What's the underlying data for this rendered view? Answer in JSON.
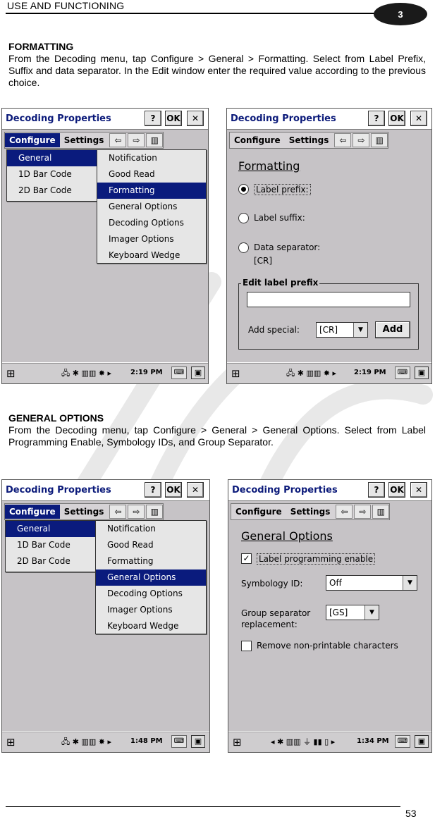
{
  "header": {
    "title": "USE AND FUNCTIONING",
    "chapter": "3"
  },
  "section1": {
    "heading": "FORMATTING",
    "text": "From the Decoding menu, tap Configure > General > Formatting. Select from Label Prefix, Suffix and data separator. In the Edit window enter the required value according to the previous choice."
  },
  "section2": {
    "heading": "GENERAL OPTIONS",
    "text": "From the Decoding menu, tap Configure > General > General Options. Select from Label Programming Enable, Symbology IDs, and Group Separator."
  },
  "footer": {
    "page_number": "53"
  },
  "app": {
    "title": "Decoding Properties",
    "help_label": "?",
    "ok_label": "OK",
    "close_label": "✕",
    "menu": {
      "configure": "Configure",
      "settings": "Settings",
      "left": "⇦",
      "right": "⇨",
      "barcode": "▥"
    },
    "general_menu": [
      "General",
      "1D Bar Code",
      "2D Bar Code"
    ],
    "sub_menu": [
      "Notification",
      "Good Read",
      "Formatting",
      "General Options",
      "Decoding Options",
      "Imager Options",
      "Keyboard Wedge"
    ]
  },
  "formatting": {
    "title": "Formatting",
    "label_prefix": "Label prefix:",
    "label_suffix": "Label suffix:",
    "data_separator": "Data separator:",
    "data_separator_value": "[CR]",
    "edit_group": "Edit label prefix",
    "add_special": "Add special:",
    "special_value": "[CR]",
    "add_button": "Add"
  },
  "general_options": {
    "title": "General Options",
    "label_programming": "Label programming enable",
    "symbology_id": "Symbology ID:",
    "symbology_value": "Off",
    "group_separator_line1": "Group separator",
    "group_separator_line2": "replacement:",
    "group_value": "[GS]",
    "remove_nonprintable": "Remove non-printable characters"
  },
  "taskbar": {
    "time1": "2:19 PM",
    "time2": "1:48 PM",
    "time3": "1:34 PM",
    "start_icon": "⊞",
    "tray": "🖧 ✱ ▥▥ ✸ ▸",
    "tray2": "◂ ✱ ▥▥ ⏚ ▮▮ ▯ ▸",
    "kbd": "⌨",
    "win": "▣"
  }
}
